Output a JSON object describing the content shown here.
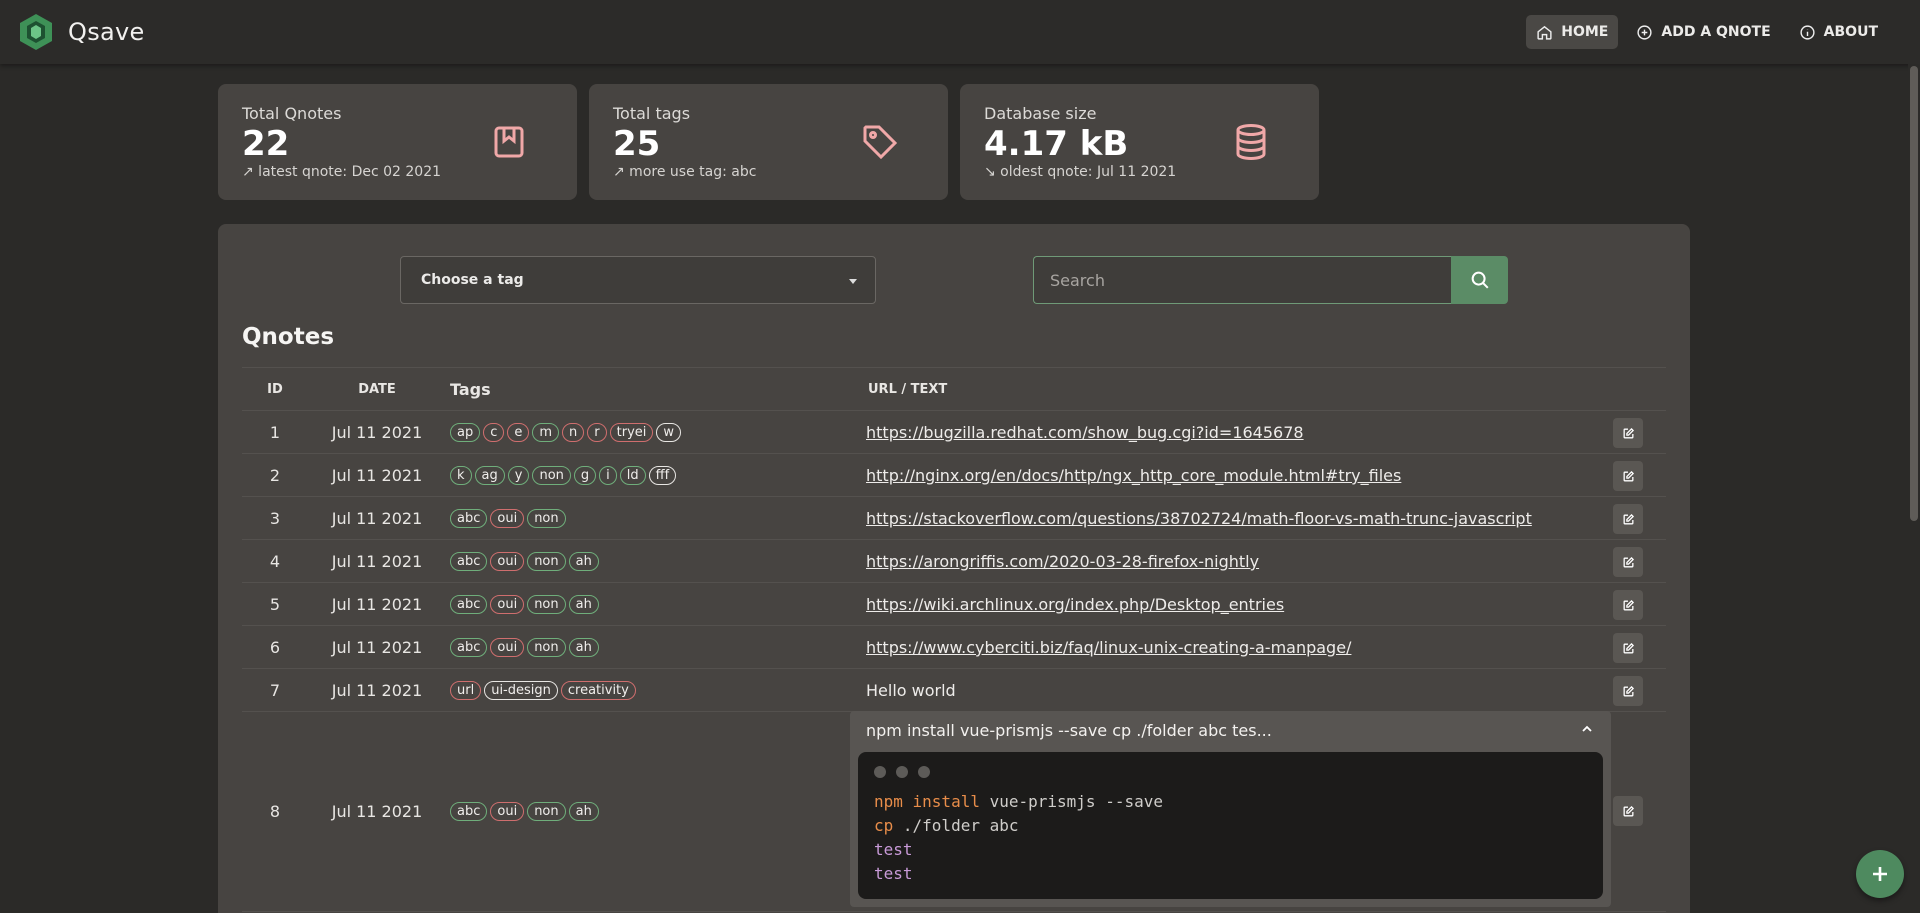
{
  "app": {
    "name": "Qsave"
  },
  "nav": [
    {
      "label": "HOME",
      "icon": "home-icon",
      "active": true
    },
    {
      "label": "ADD A QNOTE",
      "icon": "plus-circle-icon",
      "active": false
    },
    {
      "label": "ABOUT",
      "icon": "info-icon",
      "active": false
    }
  ],
  "stats": [
    {
      "label": "Total Qnotes",
      "value": "22",
      "sub": "↗ latest qnote: Dec 02 2021",
      "icon": "bookmark-icon"
    },
    {
      "label": "Total tags",
      "value": "25",
      "sub": "↗ more use tag: abc",
      "icon": "tag-icon"
    },
    {
      "label": "Database size",
      "value": "4.17 kB",
      "sub": "↘ oldest qnote: Jul 11 2021",
      "icon": "database-icon"
    }
  ],
  "filters": {
    "tag_select": "Choose a tag",
    "search_placeholder": "Search"
  },
  "table": {
    "title": "Qnotes",
    "headers": {
      "id": "ID",
      "date": "DATE",
      "tags": "Tags",
      "content": "URL / TEXT"
    },
    "rows": [
      {
        "id": "1",
        "date": "Jul 11 2021",
        "content": "https://bugzilla.redhat.com/show_bug.cgi?id=1645678",
        "tags": [
          {
            "t": "ap",
            "c": "green"
          },
          {
            "t": "c",
            "c": "red"
          },
          {
            "t": "e",
            "c": "red"
          },
          {
            "t": "m",
            "c": "green"
          },
          {
            "t": "n",
            "c": "red"
          },
          {
            "t": "r",
            "c": "red"
          },
          {
            "t": "tryei",
            "c": "red"
          },
          {
            "t": "w",
            "c": "white"
          }
        ]
      },
      {
        "id": "2",
        "date": "Jul 11 2021",
        "content": "http://nginx.org/en/docs/http/ngx_http_core_module.html#try_files",
        "tags": [
          {
            "t": "k",
            "c": "green"
          },
          {
            "t": "ag",
            "c": "green"
          },
          {
            "t": "y",
            "c": "green"
          },
          {
            "t": "non",
            "c": "green"
          },
          {
            "t": "g",
            "c": "green"
          },
          {
            "t": "i",
            "c": "green"
          },
          {
            "t": "ld",
            "c": "green"
          },
          {
            "t": "fff",
            "c": "white"
          }
        ]
      },
      {
        "id": "3",
        "date": "Jul 11 2021",
        "content": "https://stackoverflow.com/questions/38702724/math-floor-vs-math-trunc-javascript",
        "tags": [
          {
            "t": "abc",
            "c": "green"
          },
          {
            "t": "oui",
            "c": "red"
          },
          {
            "t": "non",
            "c": "green"
          }
        ]
      },
      {
        "id": "4",
        "date": "Jul 11 2021",
        "content": "https://arongriffis.com/2020-03-28-firefox-nightly",
        "tags": [
          {
            "t": "abc",
            "c": "green"
          },
          {
            "t": "oui",
            "c": "red"
          },
          {
            "t": "non",
            "c": "green"
          },
          {
            "t": "ah",
            "c": "green"
          }
        ]
      },
      {
        "id": "5",
        "date": "Jul 11 2021",
        "content": "https://wiki.archlinux.org/index.php/Desktop_entries",
        "tags": [
          {
            "t": "abc",
            "c": "green"
          },
          {
            "t": "oui",
            "c": "red"
          },
          {
            "t": "non",
            "c": "green"
          },
          {
            "t": "ah",
            "c": "green"
          }
        ]
      },
      {
        "id": "6",
        "date": "Jul 11 2021",
        "content": "https://www.cyberciti.biz/faq/linux-unix-creating-a-manpage/",
        "tags": [
          {
            "t": "abc",
            "c": "green"
          },
          {
            "t": "oui",
            "c": "red"
          },
          {
            "t": "non",
            "c": "green"
          },
          {
            "t": "ah",
            "c": "green"
          }
        ]
      },
      {
        "id": "7",
        "date": "Jul 11 2021",
        "content": "Hello world",
        "is_text": true,
        "tags": [
          {
            "t": "url",
            "c": "red"
          },
          {
            "t": "ui-design",
            "c": "white"
          },
          {
            "t": "creativity",
            "c": "red"
          }
        ]
      }
    ],
    "code_row": {
      "id": "8",
      "date": "Jul 11 2021",
      "tags": [
        {
          "t": "abc",
          "c": "green"
        },
        {
          "t": "oui",
          "c": "red"
        },
        {
          "t": "non",
          "c": "green"
        },
        {
          "t": "ah",
          "c": "green"
        }
      ],
      "title": "npm install vue-prismjs --save cp ./folder abc tes...",
      "lines": [
        {
          "kw": "npm install",
          "rest": " vue-prismjs --save"
        },
        {
          "kw": "cp",
          "rest": " ./folder abc"
        },
        {
          "lit": "test"
        },
        {
          "lit": "test"
        }
      ]
    }
  },
  "colors": {
    "green_tag": "#6fae7b",
    "red_tag": "#cf6e6e",
    "accent": "#5b8c66",
    "icon_pink": "#f0a8a8"
  }
}
